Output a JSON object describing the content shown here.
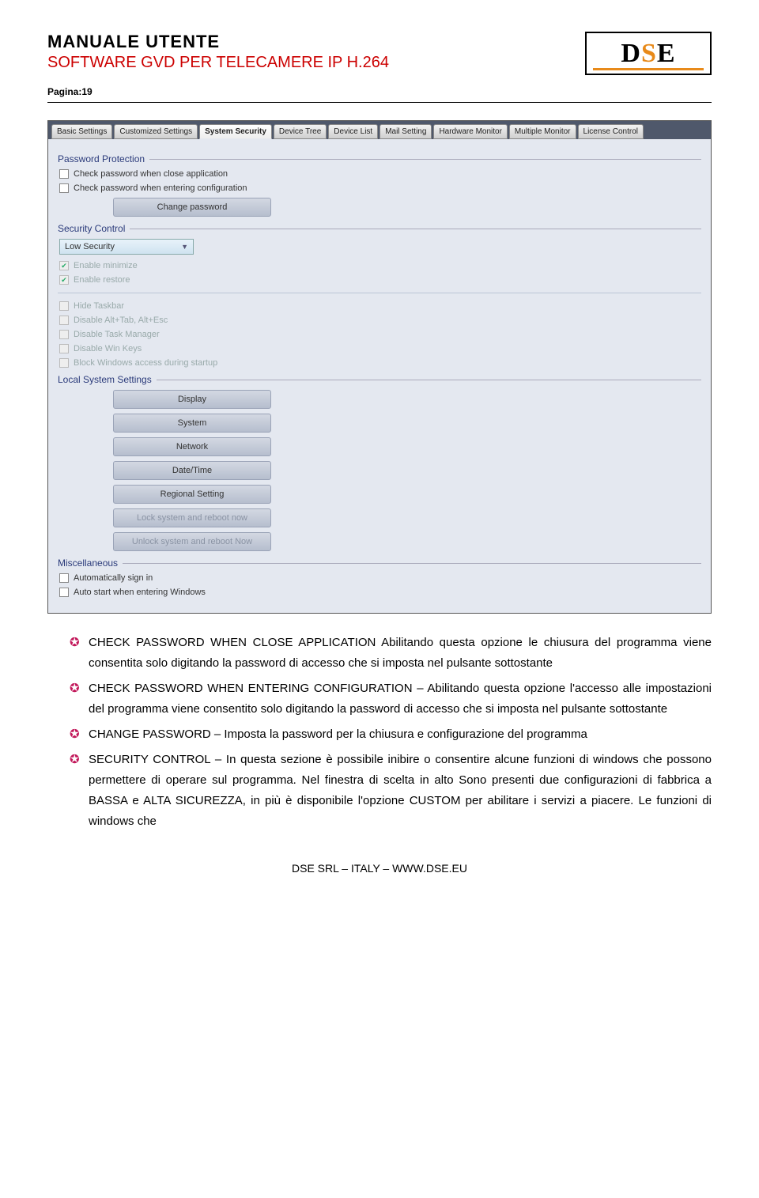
{
  "header": {
    "title": "MANUALE UTENTE",
    "subtitle": "SOFTWARE GVD PER TELECAMERE IP H.264",
    "page_label": "Pagina",
    "page_num": "19"
  },
  "logo": {
    "d": "D",
    "s": "S",
    "e": "E"
  },
  "ui": {
    "tabs": [
      "Basic Settings",
      "Customized Settings",
      "System Security",
      "Device Tree",
      "Device List",
      "Mail Setting",
      "Hardware Monitor",
      "Multiple Monitor",
      "License Control"
    ],
    "active_tab_index": 2,
    "password_section": "Password Protection",
    "chk_close": "Check password when close application",
    "chk_enter": "Check password when entering configuration",
    "btn_change_pwd": "Change password",
    "security_section": "Security Control",
    "security_level": "Low Security",
    "chk_min": "Enable minimize",
    "chk_restore": "Enable restore",
    "chk_hide_taskbar": "Hide Taskbar",
    "chk_disable_alt": "Disable Alt+Tab, Alt+Esc",
    "chk_disable_tm": "Disable Task Manager",
    "chk_disable_win": "Disable Win Keys",
    "chk_block_startup": "Block Windows access during startup",
    "local_section": "Local System Settings",
    "btn_display": "Display",
    "btn_system": "System",
    "btn_network": "Network",
    "btn_datetime": "Date/Time",
    "btn_regional": "Regional Setting",
    "btn_lock_reboot": "Lock system and reboot now",
    "btn_unlock_reboot": "Unlock system and reboot Now",
    "misc_section": "Miscellaneous",
    "chk_auto_signin": "Automatically sign in",
    "chk_auto_start": "Auto start when entering Windows"
  },
  "body": {
    "b1": "CHECK PASSWORD WHEN CLOSE APPLICATION Abilitando questa opzione le chiusura del programma viene consentita solo digitando la password di accesso che si imposta nel pulsante sottostante",
    "b2": "CHECK PASSWORD WHEN ENTERING CONFIGURATION – Abilitando questa opzione l'accesso alle impostazioni del programma viene consentito solo digitando la password di accesso che si imposta nel pulsante sottostante",
    "b3": "CHANGE PASSWORD – Imposta la password per la chiusura e configurazione del programma",
    "b4": "SECURITY CONTROL – In questa sezione è possibile inibire o consentire alcune funzioni di windows che possono permettere di operare sul programma. Nel finestra di scelta in alto Sono presenti due configurazioni di fabbrica a BASSA e ALTA SICUREZZA, in più è disponibile l'opzione CUSTOM per abilitare i servizi a piacere. Le funzioni di windows che"
  },
  "footer": "DSE SRL – ITALY – WWW.DSE.EU"
}
